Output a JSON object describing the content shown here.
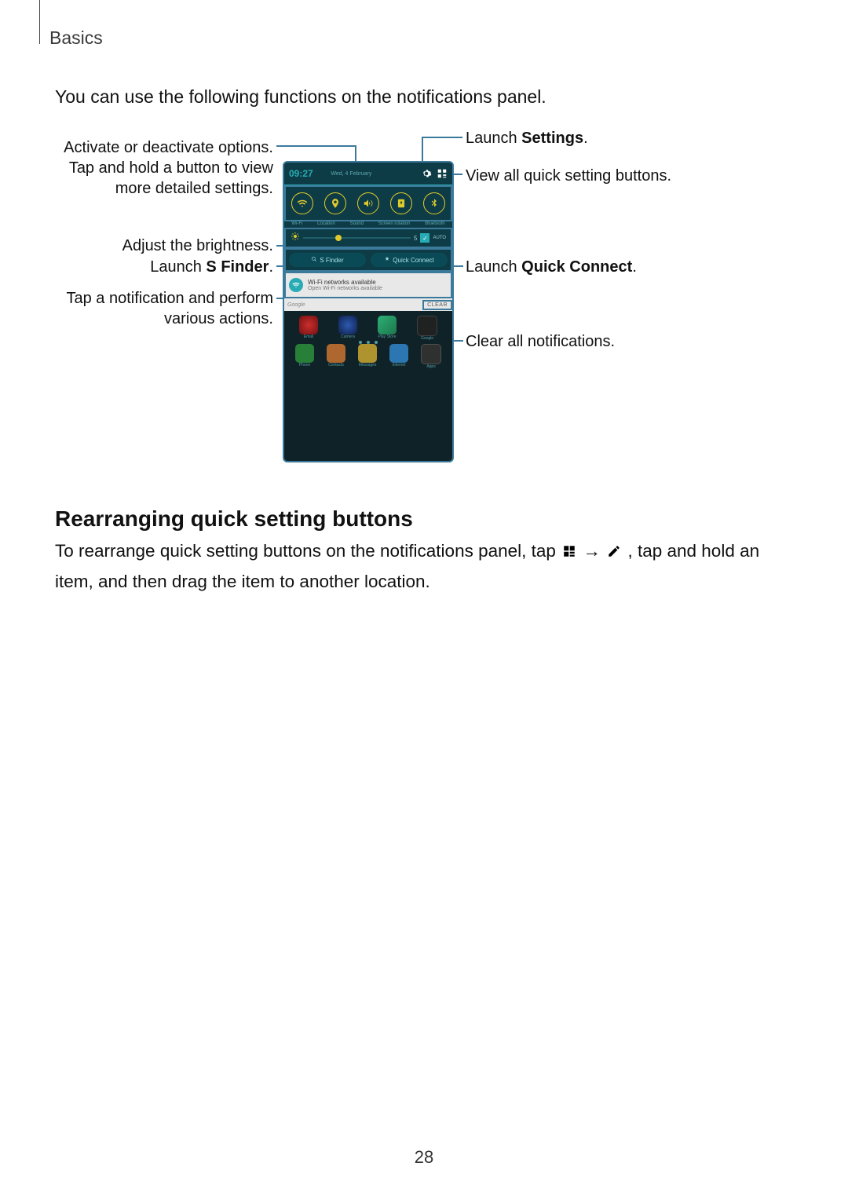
{
  "header": {
    "section": "Basics"
  },
  "intro": "You can use the following functions on the notifications panel.",
  "callouts": {
    "left": {
      "options": "Activate or deactivate options. Tap and hold a button to view more detailed settings.",
      "brightness": "Adjust the brightness.",
      "sfinder_pre": "Launch ",
      "sfinder_bold": "S Finder",
      "sfinder_post": ".",
      "notification": "Tap a notification and perform various actions."
    },
    "right": {
      "settings_pre": "Launch ",
      "settings_bold": "Settings",
      "settings_post": ".",
      "viewall": "View all quick setting buttons.",
      "quickconnect_pre": "Launch ",
      "quickconnect_bold": "Quick Connect",
      "quickconnect_post": ".",
      "clear": "Clear all notifications."
    }
  },
  "phone": {
    "time": "09:27",
    "date": "Wed, 4 February",
    "quick_labels": [
      "Wi-Fi",
      "Location",
      "Sound",
      "Screen rotation",
      "Bluetooth"
    ],
    "brightness_value": "5",
    "auto_label": "AUTO",
    "sfinder": "S Finder",
    "quickconnect": "Quick Connect",
    "notif_title": "Wi-Fi networks available",
    "notif_sub": "Open Wi-Fi networks available",
    "google": "Google",
    "clear": "CLEAR",
    "dock": [
      "Phone",
      "Contacts",
      "Messages",
      "Internet",
      "Apps"
    ],
    "apps_row": [
      "Email",
      "Camera",
      "Play Store",
      "Google"
    ]
  },
  "section": {
    "heading": "Rearranging quick setting buttons",
    "para_a": "To rearrange quick setting buttons on the notifications panel, tap ",
    "arrow": "→",
    "para_b": ", tap and hold an item, and then drag the item to another location."
  },
  "page_number": "28"
}
